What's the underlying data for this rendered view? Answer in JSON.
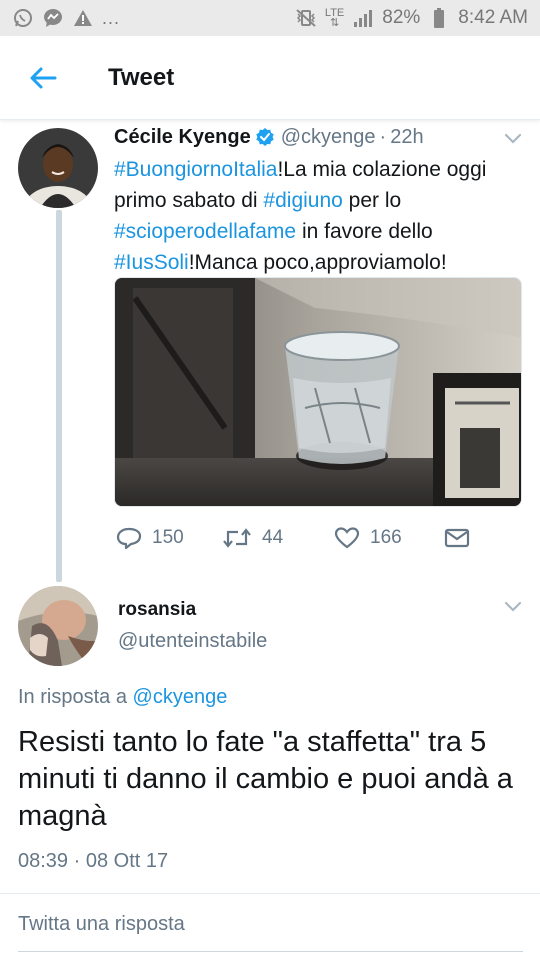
{
  "status_bar": {
    "notification_dots": "...",
    "lte_label": "LTE",
    "battery": "82%",
    "time": "8:42 AM"
  },
  "header": {
    "title": "Tweet",
    "back_icon": "arrow-left-icon",
    "accent_color": "#1da1f2"
  },
  "original_tweet": {
    "name": "Cécile Kyenge",
    "verified": true,
    "handle": "@ckyenge",
    "separator": "·",
    "time": "22h",
    "segments": [
      {
        "text": "#BuongiornoItalia",
        "hashtag": true
      },
      {
        "text": "!La mia colazione oggi primo sabato di ",
        "hashtag": false
      },
      {
        "text": "#digiuno",
        "hashtag": true
      },
      {
        "text": " per lo ",
        "hashtag": false
      },
      {
        "text": "#scioperodellafame",
        "hashtag": true
      },
      {
        "text": " in favore dello ",
        "hashtag": false
      },
      {
        "text": "#IusSoli",
        "hashtag": true
      },
      {
        "text": "!Manca poco,approviamolo!",
        "hashtag": false
      }
    ],
    "actions": {
      "replies": "150",
      "retweets": "44",
      "likes": "166"
    }
  },
  "reply_tweet": {
    "name": "rosansia",
    "handle": "@utenteinstabile",
    "in_reply_prefix": "In risposta a",
    "in_reply_handle": "@ckyenge",
    "text": "Resisti tanto lo fate \"a staffetta\" tra 5 minuti ti danno il cambio e puoi andà a magnà",
    "time": "08:39",
    "separator": "·",
    "date": "08 Ott 17"
  },
  "composer": {
    "placeholder": "Twitta una risposta"
  },
  "colors": {
    "hashtag": "#1b95e0",
    "secondary_text": "#657786",
    "thread_line": "#ccd6dd"
  }
}
